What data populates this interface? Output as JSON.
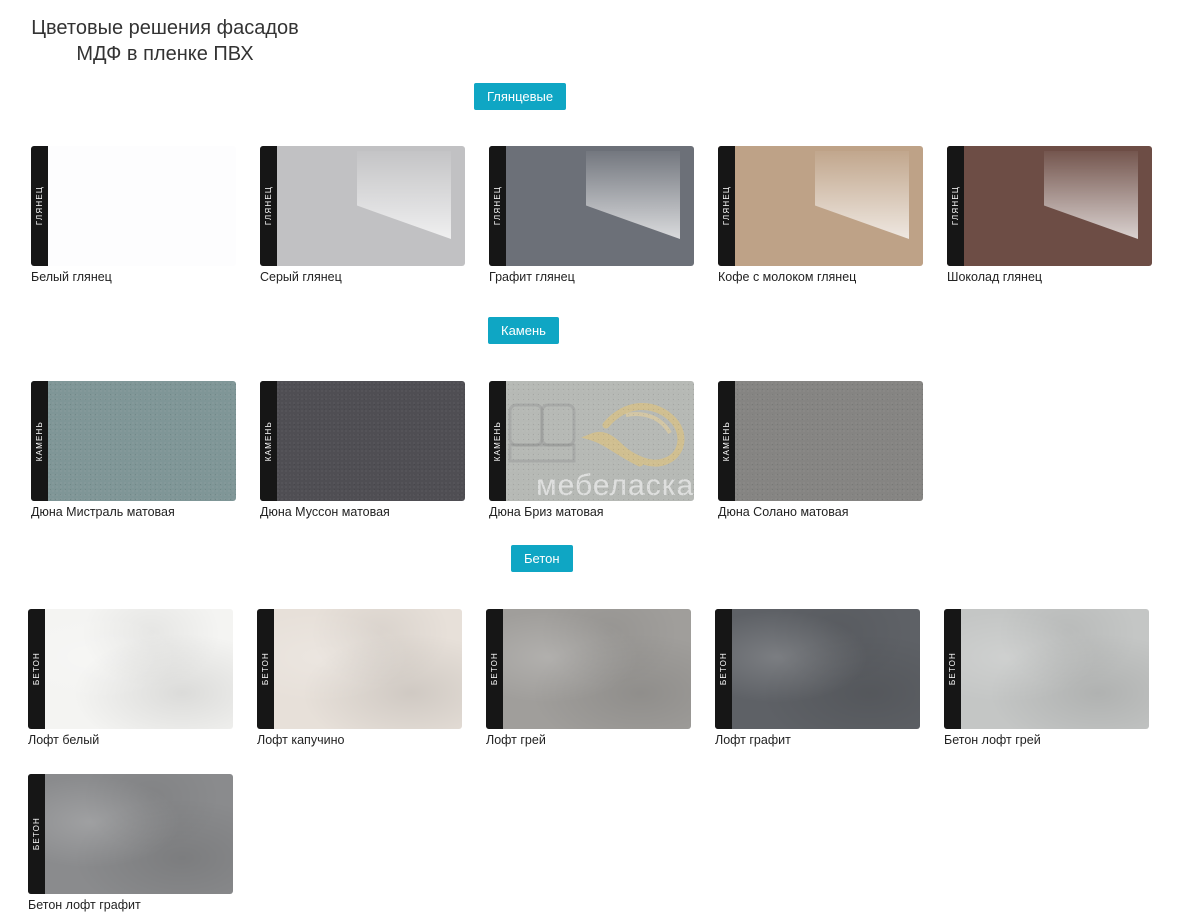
{
  "title": {
    "line1": "Цветовые решения фасадов",
    "line2": "МДФ в пленке ПВХ"
  },
  "sections": [
    {
      "label": "Глянцевые",
      "items": [
        {
          "name": "Белый глянец",
          "tag": "ГЛЯНЕЦ",
          "color": "#fdfdfe"
        },
        {
          "name": "Серый глянец",
          "tag": "ГЛЯНЕЦ",
          "color": "#c1c1c3"
        },
        {
          "name": "Графит глянец",
          "tag": "ГЛЯНЕЦ",
          "color": "#6c7078"
        },
        {
          "name": "Кофе с молоком глянец",
          "tag": "ГЛЯНЕЦ",
          "color": "#bea287"
        },
        {
          "name": "Шоколад глянец",
          "tag": "ГЛЯНЕЦ",
          "color": "#6d4d45"
        }
      ]
    },
    {
      "label": "Камень",
      "items": [
        {
          "name": "Дюна Мистраль матовая",
          "tag": "КАМЕНЬ",
          "color": "#7f9697"
        },
        {
          "name": "Дюна Муссон матовая",
          "tag": "КАМЕНЬ",
          "color": "#4f4e53"
        },
        {
          "name": "Дюна Бриз матовая",
          "tag": "КАМЕНЬ",
          "color": "#b6b9b5"
        },
        {
          "name": "Дюна Солано матовая",
          "tag": "КАМЕНЬ",
          "color": "#858482"
        }
      ]
    },
    {
      "label": "Бетон",
      "items": [
        {
          "name": "Лофт белый",
          "tag": "БЕТОН",
          "color": "#f4f4f2"
        },
        {
          "name": "Лофт капучино",
          "tag": "БЕТОН",
          "color": "#e7e0d9"
        },
        {
          "name": "Лофт грей",
          "tag": "БЕТОН",
          "color": "#a09e9b"
        },
        {
          "name": "Лофт графит",
          "tag": "БЕТОН",
          "color": "#5e6166"
        },
        {
          "name": "Бетон лофт грей",
          "tag": "БЕТОН",
          "color": "#c4c6c5"
        },
        {
          "name": "Бетон лофт графит",
          "tag": "БЕТОН",
          "color": "#8a8b8d"
        }
      ]
    }
  ],
  "watermark": "мебеласка",
  "accent_color": "#0fa6c4"
}
